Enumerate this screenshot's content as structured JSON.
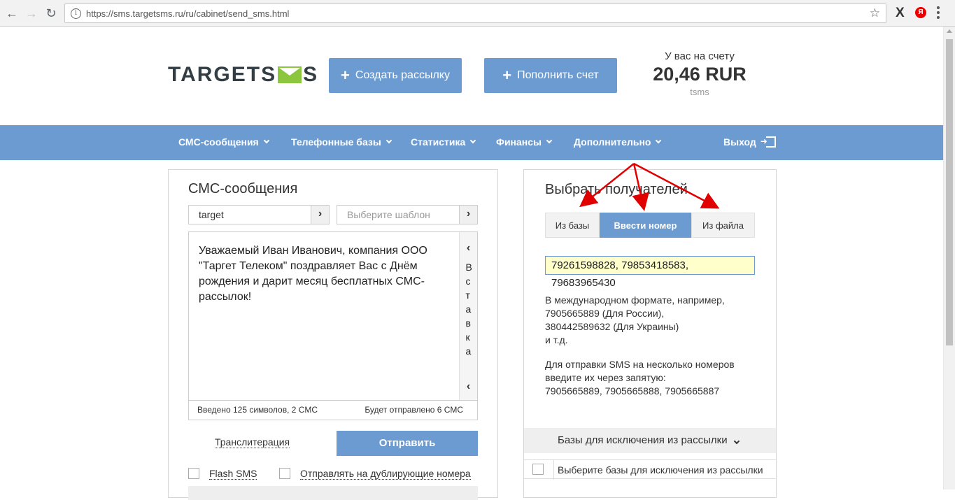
{
  "browser": {
    "url": "https://sms.targetsms.ru/ru/cabinet/send_sms.html",
    "ext_ya": "Я"
  },
  "header": {
    "logo_left": "TARGETS",
    "logo_right": "S",
    "create_label": "Создать рассылку",
    "topup_label": "Пополнить счет",
    "balance_label": "У вас на счету",
    "balance_amount": "20,46 RUR",
    "balance_unit": "tsms"
  },
  "nav": {
    "items": [
      "СМС-сообщения",
      "Телефонные базы",
      "Статистика",
      "Финансы",
      "Дополнительно"
    ],
    "logout": "Выход"
  },
  "sms_panel": {
    "title": "СМС-сообщения",
    "sender": "target",
    "template_placeholder": "Выберите шаблон",
    "message": "Уважаемый Иван Иванович, компания ООО \"Таргет Телеком\" поздравляет Вас с Днём рождения и дарит месяц бесплатных СМС-рассылок!",
    "insert_label": "В с т а в к а",
    "entered": "Введено 125 символов, 2 СМС",
    "to_send": "Будет отправлено 6 СМС",
    "translit": "Транслитерация",
    "send": "Отправить",
    "flash": "Flash SMS",
    "duplicates": "Отправлять на дублирующие номера"
  },
  "recipients_panel": {
    "title": "Выбрать получателей",
    "tabs": [
      "Из базы",
      "Ввести номер",
      "Из файла"
    ],
    "active_tab": "Ввести номер",
    "phones": "79261598828, 79853418583, 79683965430",
    "help1": [
      "В международном формате, например,",
      "7905665889 (Для России),",
      "380442589632 (Для Украины)",
      "и т.д."
    ],
    "help2": [
      "Для отправки SMS на несколько номеров",
      "введите их через запятую:",
      "7905665889, 7905665888, 7905665887"
    ],
    "exclude_title": "Базы для исключения из рассылки",
    "exclude_placeholder": "Выберите базы для исключения из рассылки"
  },
  "colors": {
    "accent": "#6b9bd1",
    "annotation": "#e00000",
    "input_bg": "#ffffcc"
  }
}
